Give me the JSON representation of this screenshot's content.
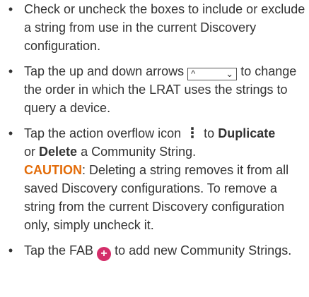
{
  "bullet_char": "•",
  "colors": {
    "text": "#333333",
    "caution": "#e36c09",
    "fab": "#d42e6a"
  },
  "items": [
    {
      "text": "Check or uncheck the boxes to include or exclude a string from use in the current Discovery configuration."
    },
    {
      "before": "Tap the up and down arrows",
      "up_arrow": "^",
      "down_arrow": "⌄",
      "after": "to change the order in which the LRAT uses the strings to query a device."
    },
    {
      "before": "Tap the action overflow icon",
      "overflow_glyph": "⋮",
      "middle1": "to",
      "duplicate": "Duplicate",
      "middle2": "or",
      "delete": "Delete",
      "after": "a Community String.",
      "caution_label": "CAUTION",
      "caution_text": ": Deleting a string removes it from all saved Discovery configurations. To remove a string from the current Discovery configuration only, simply uncheck it."
    },
    {
      "before": "Tap the FAB",
      "fab_glyph": "+",
      "after": "to add new Community Strings."
    }
  ],
  "icons": {
    "reorder": "up-down-arrows-icon",
    "overflow": "overflow-menu-icon",
    "fab": "fab-plus-icon"
  }
}
